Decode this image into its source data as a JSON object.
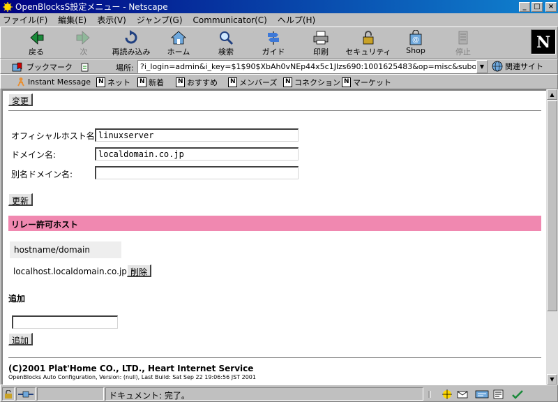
{
  "window": {
    "title": "OpenBlocksS設定メニュー - Netscape",
    "controls": {
      "minimize": "_",
      "maximize": "□",
      "close": "×"
    }
  },
  "menu": [
    "ファイル(F)",
    "編集(E)",
    "表示(V)",
    "ジャンプ(G)",
    "Communicator(C)",
    "ヘルプ(H)"
  ],
  "toolbar": {
    "back": "戻る",
    "forward": "次",
    "reload": "再読み込み",
    "home": "ホーム",
    "search": "検索",
    "guide": "ガイド",
    "print": "印刷",
    "security": "セキュリティ",
    "shop": "Shop",
    "stop": "停止"
  },
  "location": {
    "bookmarks": "ブックマーク",
    "label": "場所:",
    "url": "?i_login=admin&i_key=$1$90$XbAh0vNEp44x5c1Jlzs690:1001625483&op=misc&subop=sendmail",
    "related": "関連サイト"
  },
  "personal_toolbar": [
    "Instant Message",
    "ネット",
    "新着",
    "おすすめ",
    "メンバーズ",
    "コネクション",
    "マーケット"
  ],
  "form": {
    "change_button": "変更",
    "hostname_label": "オフィシャルホスト名:",
    "hostname_value": "linuxserver",
    "domain_label": "ドメイン名:",
    "domain_value": "localdomain.co.jp",
    "alias_label": "別名ドメイン名:",
    "alias_value": "",
    "update_button": "更新"
  },
  "relay": {
    "heading": "リレー許可ホスト",
    "column_header": "hostname/domain",
    "rows": [
      {
        "host": "localhost.localdomain.co.jp",
        "delete_label": "削除"
      }
    ],
    "add_heading": "追加",
    "add_value": "",
    "add_button": "追加"
  },
  "footer": {
    "copyright": "(C)2001 Plat'Home CO., LTD., Heart Internet Service",
    "build": "OpenBlocks Auto Configuration, Version: (null), Last Build: Sat Sep 22 19:06:56 JST 2001"
  },
  "status": {
    "text": "ドキュメント: 完了。"
  },
  "colors": {
    "section_bar": "#f088b0",
    "title_bar": "#000080",
    "chrome": "#c0c0c0"
  }
}
